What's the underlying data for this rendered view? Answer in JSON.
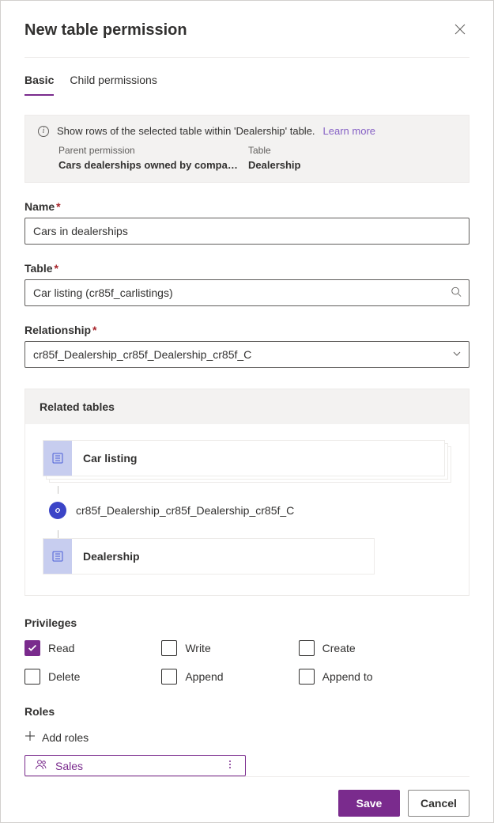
{
  "header": {
    "title": "New table permission"
  },
  "tabs": {
    "basic": "Basic",
    "child": "Child permissions"
  },
  "info": {
    "text": "Show rows of the selected table within 'Dealership' table.",
    "learn_more": "Learn more",
    "parent_label": "Parent permission",
    "parent_value": "Cars dealerships owned by compa…",
    "table_label": "Table",
    "table_value": "Dealership"
  },
  "fields": {
    "name_label": "Name",
    "name_value": "Cars in dealerships",
    "table_label": "Table",
    "table_value": "Car listing (cr85f_carlistings)",
    "relationship_label": "Relationship",
    "relationship_value": "cr85f_Dealership_cr85f_Dealership_cr85f_C"
  },
  "related": {
    "header": "Related tables",
    "entity1": "Car listing",
    "relationship": "cr85f_Dealership_cr85f_Dealership_cr85f_C",
    "entity2": "Dealership"
  },
  "privileges": {
    "label": "Privileges",
    "read": "Read",
    "write": "Write",
    "create": "Create",
    "delete": "Delete",
    "append": "Append",
    "append_to": "Append to"
  },
  "roles": {
    "label": "Roles",
    "add": "Add roles",
    "chip": "Sales"
  },
  "footer": {
    "save": "Save",
    "cancel": "Cancel"
  }
}
